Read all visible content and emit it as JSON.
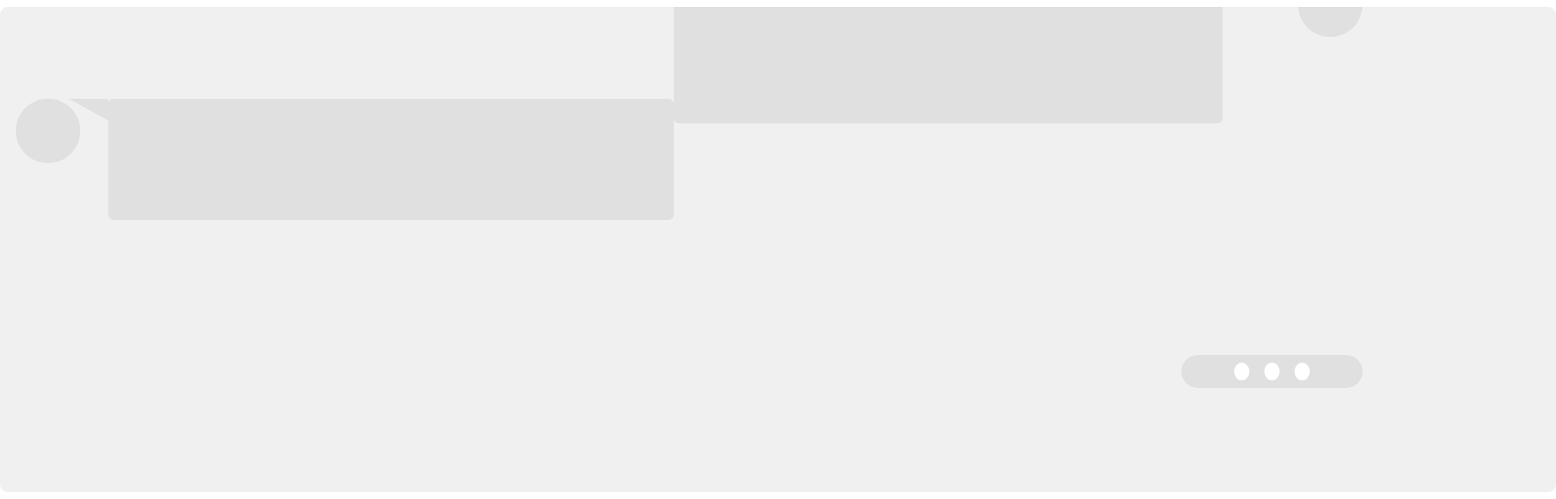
{
  "chat": {
    "messages": [
      {
        "sender": "self",
        "text": ""
      },
      {
        "sender": "other",
        "text": ""
      }
    ],
    "typing_indicator": {
      "dots": 3,
      "icon": "typing-dots-icon"
    }
  },
  "colors": {
    "background": "#f0f0f0",
    "placeholder": "#e0e0e0",
    "dot": "#ffffff"
  }
}
